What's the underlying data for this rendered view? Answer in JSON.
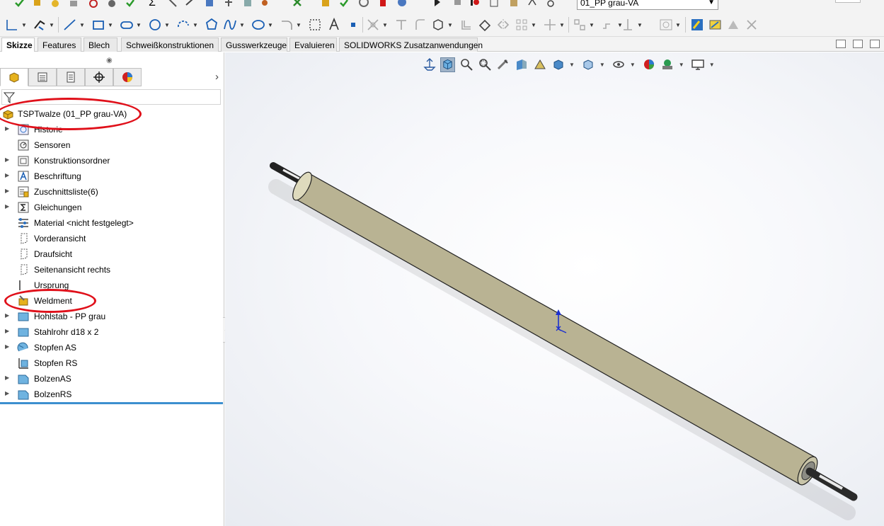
{
  "toolbar": {
    "configuration_value": "01_PP grau-VA",
    "top_icons": [
      "check-icon",
      "magic-wand-icon",
      "light-icon",
      "rebuild-icon",
      "options-icon",
      "measure-icon",
      "sum-icon",
      "evaluate-icon",
      "cut-list-icon",
      "check-icon",
      "stop-icon",
      "play-icon",
      "pause-icon",
      "record-icon",
      "macro-icon",
      "edit-icon",
      "add-icon",
      "close-icon"
    ],
    "sketch_tools": [
      "smart-dimension-icon",
      "line-icon",
      "rectangle-icon",
      "slot-icon",
      "circle-icon",
      "arc-icon",
      "polygon-icon",
      "spline-icon",
      "ellipse-icon",
      "fillet-icon",
      "plane-icon",
      "text-icon",
      "point-icon",
      "trim-icon",
      "convert-icon",
      "offset-icon",
      "mirror-icon",
      "pattern-icon",
      "move-icon",
      "relations-icon",
      "repair-icon",
      "quick-snaps-icon",
      "rapid-sketch-icon",
      "instant2d-icon",
      "shaded-sketch-icon"
    ]
  },
  "tabs": [
    {
      "label": "Skizze",
      "active": true
    },
    {
      "label": "Features",
      "active": false
    },
    {
      "label": "Blech",
      "active": false
    },
    {
      "label": "Schweißkonstruktionen",
      "active": false
    },
    {
      "label": "Gusswerkzeuge",
      "active": false
    },
    {
      "label": "Evaluieren",
      "active": false
    },
    {
      "label": "SOLIDWORKS Zusatzanwendungen",
      "active": false
    }
  ],
  "panel_tabs": [
    "feature-manager-icon",
    "property-manager-icon",
    "configuration-manager-icon",
    "dimxpert-icon",
    "display-manager-icon"
  ],
  "tree": {
    "root": {
      "label": "TSPTwalze  (01_PP grau-VA)",
      "icon": "part-icon"
    },
    "items": [
      {
        "label": "Historie",
        "icon": "history-icon",
        "expandable": true
      },
      {
        "label": "Sensoren",
        "icon": "sensor-icon",
        "expandable": false
      },
      {
        "label": "Konstruktionsordner",
        "icon": "design-folder-icon",
        "expandable": true
      },
      {
        "label": "Beschriftung",
        "icon": "annotations-icon",
        "expandable": true
      },
      {
        "label": "Zuschnittsliste(6)",
        "icon": "cut-list-icon",
        "expandable": true
      },
      {
        "label": "Gleichungen",
        "icon": "equations-icon",
        "expandable": true
      },
      {
        "label": "Material <nicht festgelegt>",
        "icon": "material-icon",
        "expandable": false
      },
      {
        "label": "Vorderansicht",
        "icon": "plane-icon",
        "expandable": false
      },
      {
        "label": "Draufsicht",
        "icon": "plane-icon",
        "expandable": false
      },
      {
        "label": "Seitenansicht rechts",
        "icon": "plane-icon",
        "expandable": false
      },
      {
        "label": "Ursprung",
        "icon": "origin-icon",
        "expandable": false
      },
      {
        "label": "Weldment",
        "icon": "weldment-icon",
        "expandable": false
      },
      {
        "label": "Hohlstab - PP grau",
        "icon": "structural-member-icon",
        "expandable": true
      },
      {
        "label": "Stahlrohr d18 x 2",
        "icon": "structural-member-icon",
        "expandable": true
      },
      {
        "label": "Stopfen AS",
        "icon": "revolve-icon",
        "expandable": true
      },
      {
        "label": "Stopfen RS",
        "icon": "revolve-cut-icon",
        "expandable": false
      },
      {
        "label": "BolzenAS",
        "icon": "extrude-icon",
        "expandable": true
      },
      {
        "label": "BolzenRS",
        "icon": "extrude-icon",
        "expandable": true
      }
    ]
  },
  "heads_up_toolbar": [
    "normal-to-icon",
    "view-orientation-icon",
    "zoom-to-fit-icon",
    "zoom-to-area-icon",
    "previous-view-icon",
    "section-view-icon",
    "dynamic-annotation-icon",
    "display-style-icon",
    "hide-show-icon",
    "edit-appearance-icon",
    "apply-scene-icon",
    "view-settings-icon"
  ],
  "colors": {
    "annotation_ellipse": "#e0101a",
    "roller_body": "#e6e2c4",
    "selection_blue": "#3c8fcf"
  }
}
